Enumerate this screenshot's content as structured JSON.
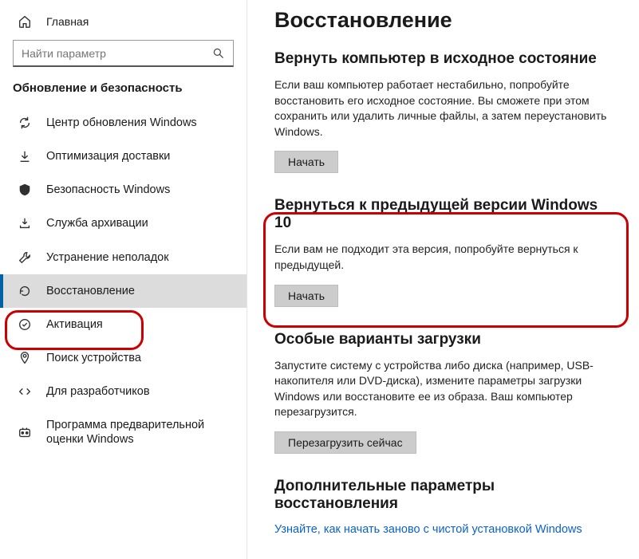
{
  "sidebar": {
    "home_label": "Главная",
    "search_placeholder": "Найти параметр",
    "category_label": "Обновление и безопасность",
    "items": [
      {
        "label": "Центр обновления Windows"
      },
      {
        "label": "Оптимизация доставки"
      },
      {
        "label": "Безопасность Windows"
      },
      {
        "label": "Служба архивации"
      },
      {
        "label": "Устранение неполадок"
      },
      {
        "label": "Восстановление"
      },
      {
        "label": "Активация"
      },
      {
        "label": "Поиск устройства"
      },
      {
        "label": "Для разработчиков"
      },
      {
        "label": "Программа предварительной оценки Windows"
      }
    ]
  },
  "main": {
    "title": "Восстановление",
    "reset": {
      "heading": "Вернуть компьютер в исходное состояние",
      "body": "Если ваш компьютер работает нестабильно, попробуйте восстановить его исходное состояние. Вы сможете при этом сохранить или удалить личные файлы, а затем переустановить Windows.",
      "button": "Начать"
    },
    "previous": {
      "heading": "Вернуться к предыдущей версии Windows 10",
      "body": "Если вам не подходит эта версия, попробуйте вернуться к предыдущей.",
      "button": "Начать"
    },
    "advanced": {
      "heading": "Особые варианты загрузки",
      "body": "Запустите систему с устройства либо диска (например, USB-накопителя или DVD-диска), измените параметры загрузки Windows или восстановите ее из образа. Ваш компьютер перезагрузится.",
      "button": "Перезагрузить сейчас"
    },
    "more": {
      "heading": "Дополнительные параметры восстановления",
      "link": "Узнайте, как начать заново с чистой установкой Windows"
    }
  }
}
